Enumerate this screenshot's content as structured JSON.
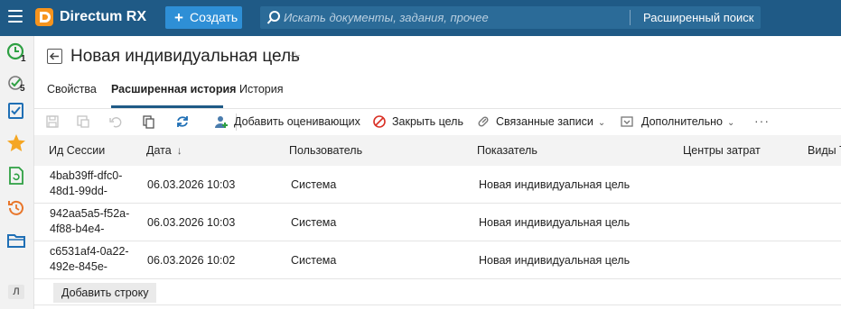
{
  "topbar": {
    "app_name": "Directum RX",
    "create_label": "Создать",
    "search_placeholder": "Искать документы, задания, прочее",
    "advanced_search_label": "Расширенный поиск",
    "bg_color": "#1f5a86",
    "accent_color": "#2e8fd6",
    "logo_color": "#f7941d"
  },
  "sidebar": {
    "items": [
      {
        "icon": "clock-icon",
        "badge": "1"
      },
      {
        "icon": "check-circle-icon",
        "badge": "5"
      },
      {
        "icon": "task-list-icon"
      },
      {
        "icon": "star-icon"
      },
      {
        "icon": "document-refresh-icon"
      },
      {
        "icon": "history-icon"
      },
      {
        "icon": "folder-icon"
      }
    ],
    "user_initial": "Л"
  },
  "page": {
    "title": "Новая индивидуальная цель"
  },
  "tabs": [
    {
      "label": "Свойства",
      "active": false
    },
    {
      "label": "Расширенная история",
      "active": true
    },
    {
      "label": "История",
      "active": false
    }
  ],
  "toolbar": {
    "add_evaluators": "Добавить оценивающих",
    "close_goal": "Закрыть цель",
    "related_records": "Связанные записи",
    "additional": "Дополнительно",
    "more": "···"
  },
  "table": {
    "columns": [
      "Ид Сессии",
      "Дата",
      "Пользователь",
      "Показатель",
      "Центры затрат",
      "Виды Т"
    ],
    "sort_indicator": "↓",
    "rows": [
      {
        "session_id": "4bab39ff-dfc0-48d1-99dd-",
        "date": "06.03.2026 10:03",
        "user": "Система",
        "indicator": "Новая индивидуальная цель"
      },
      {
        "session_id": "942aa5a5-f52a-4f88-b4e4-",
        "date": "06.03.2026 10:03",
        "user": "Система",
        "indicator": "Новая индивидуальная цель"
      },
      {
        "session_id": "c6531af4-0a22-492e-845e-",
        "date": "06.03.2026 10:02",
        "user": "Система",
        "indicator": "Новая индивидуальная цель"
      }
    ],
    "add_row_label": "Добавить строку"
  }
}
